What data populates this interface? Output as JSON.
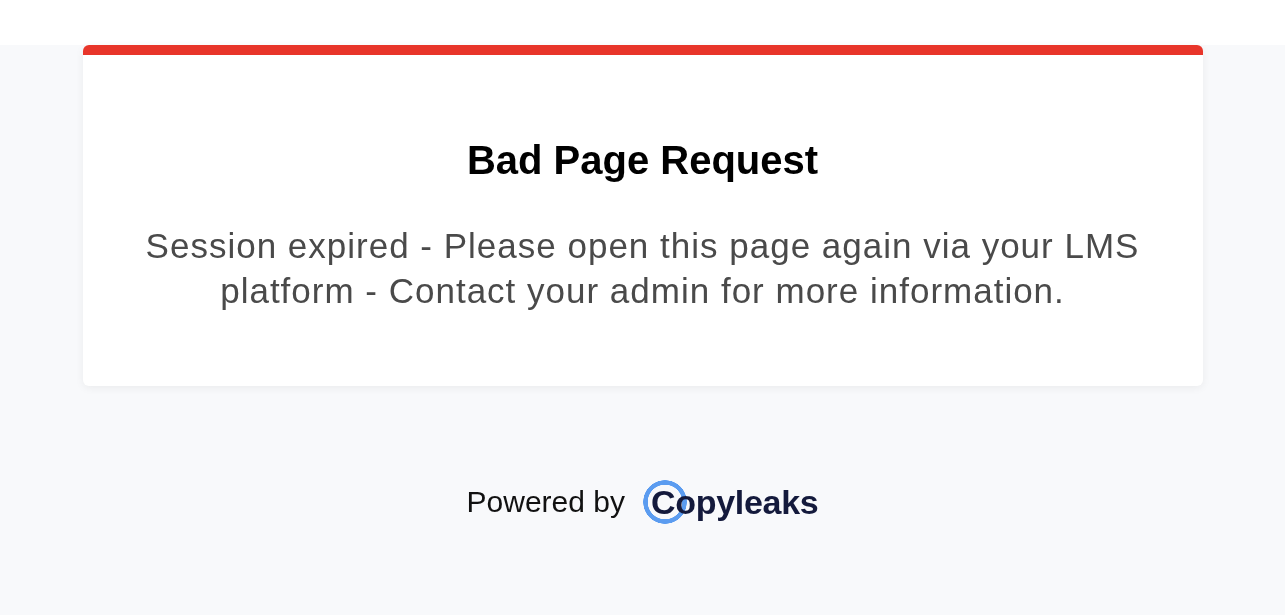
{
  "card": {
    "kind": "error",
    "title": "Bad Page Request",
    "message": "Session expired - Please open this page again via your LMS platform - Contact your admin for more information."
  },
  "footer": {
    "powered_by": "Powered by",
    "logo_text": "Copyleaks"
  }
}
